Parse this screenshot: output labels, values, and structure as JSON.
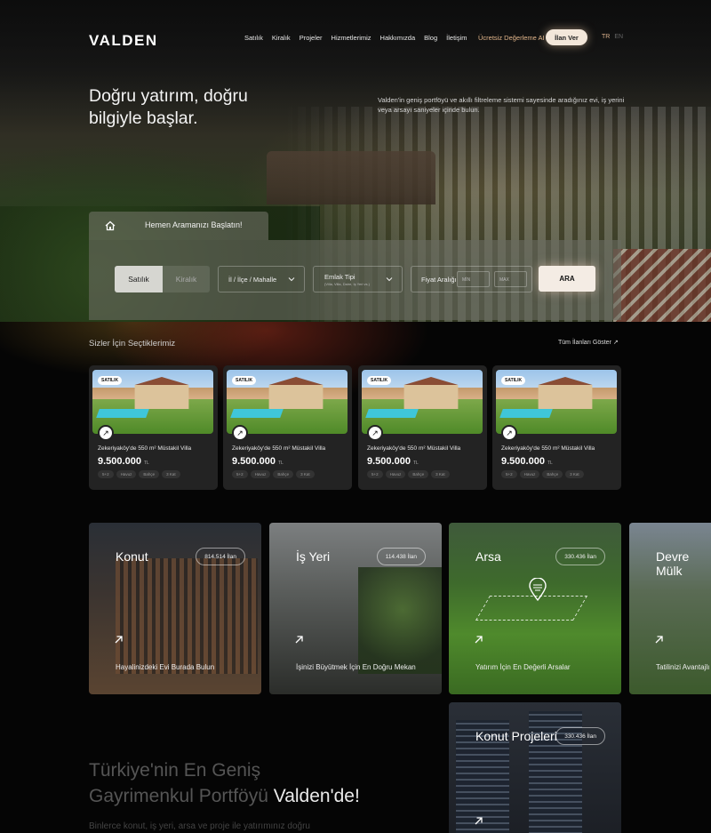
{
  "brand": "VALDEN",
  "nav": {
    "items": [
      "Satılık",
      "Kiralık",
      "Projeler",
      "Hizmetlerimiz",
      "Hakkımızda",
      "Blog",
      "İletişim"
    ],
    "free_valuation": "Ücretsiz Değerleme AI",
    "post_ad": "İlan Ver",
    "lang_tr": "TR",
    "lang_en": "EN"
  },
  "hero": {
    "title": "Doğru yatırım, doğru bilgiyle başlar.",
    "description": "Valden'in geniş portföyü ve akıllı filtreleme sistemi sayesinde aradığınız evi, iş yerini veya arsayı saniyeler içinde bulun."
  },
  "search": {
    "tab_label": "Hemen Aramanızı Başlatın!",
    "sale": "Satılık",
    "rent": "Kiralık",
    "location_placeholder": "İl / İlçe / Mahalle",
    "type_label": "Emlak Tipi",
    "type_sub": "(Villa, Villa, Daire, Iş Yeri vs.)",
    "price_label": "Fiyat Aralığı",
    "min": "MİN",
    "max": "MAX",
    "submit": "ARA"
  },
  "picks": {
    "title": "Sizler İçin Seçtiklerimiz",
    "show_all": "Tüm İlanları Göster",
    "cards": [
      {
        "badge": "SATILIK",
        "title": "Zekeriyaköy'de 550 m² Müstakil Villa",
        "price": "9.500.000",
        "currency": "TL",
        "tags": [
          "5+2",
          "Havuz",
          "Bahçe",
          "3 Kat"
        ]
      },
      {
        "badge": "SATILIK",
        "title": "Zekeriyaköy'de 550 m² Müstakil Villa",
        "price": "9.500.000",
        "currency": "TL",
        "tags": [
          "5+2",
          "Havuz",
          "Bahçe",
          "3 Kat"
        ]
      },
      {
        "badge": "SATILIK",
        "title": "Zekeriyaköy'de 550 m² Müstakil Villa",
        "price": "9.500.000",
        "currency": "TL",
        "tags": [
          "5+2",
          "Havuz",
          "Bahçe",
          "3 Kat"
        ]
      },
      {
        "badge": "SATILIK",
        "title": "Zekeriyaköy'de 550 m² Müstakil Villa",
        "price": "9.500.000",
        "currency": "TL",
        "tags": [
          "5+2",
          "Havuz",
          "Bahçe",
          "3 Kat"
        ]
      }
    ]
  },
  "categories": [
    {
      "name": "Konut",
      "count": "814.514 İlan",
      "desc": "Hayalinizdeki Evi Burada Bulun"
    },
    {
      "name": "İş Yeri",
      "count": "114.438 İlan",
      "desc": "İşinizi Büyütmek İçin En Doğru Mekan"
    },
    {
      "name": "Arsa",
      "count": "330.436 İlan",
      "desc": "Yatırım İçin En Değerli Arsalar"
    },
    {
      "name": "Devre Mülk",
      "count": "",
      "desc": "Tatilinizi Avantajlı"
    },
    {
      "name": "Konut Projeleri",
      "count": "330.436 İlan",
      "desc": ""
    }
  ],
  "portfolio": {
    "line1": "Türkiye'nin En Geniş",
    "line2_prefix": "Gayrimenkul Portföyü",
    "line2_highlight": "Valden'de!",
    "description": "Binlerce konut, iş yeri, arsa ve proje ile yatırımınız doğru"
  },
  "colors": {
    "accent": "#e0b48a",
    "button_bg": "#f3e7da",
    "background": "#050505"
  }
}
